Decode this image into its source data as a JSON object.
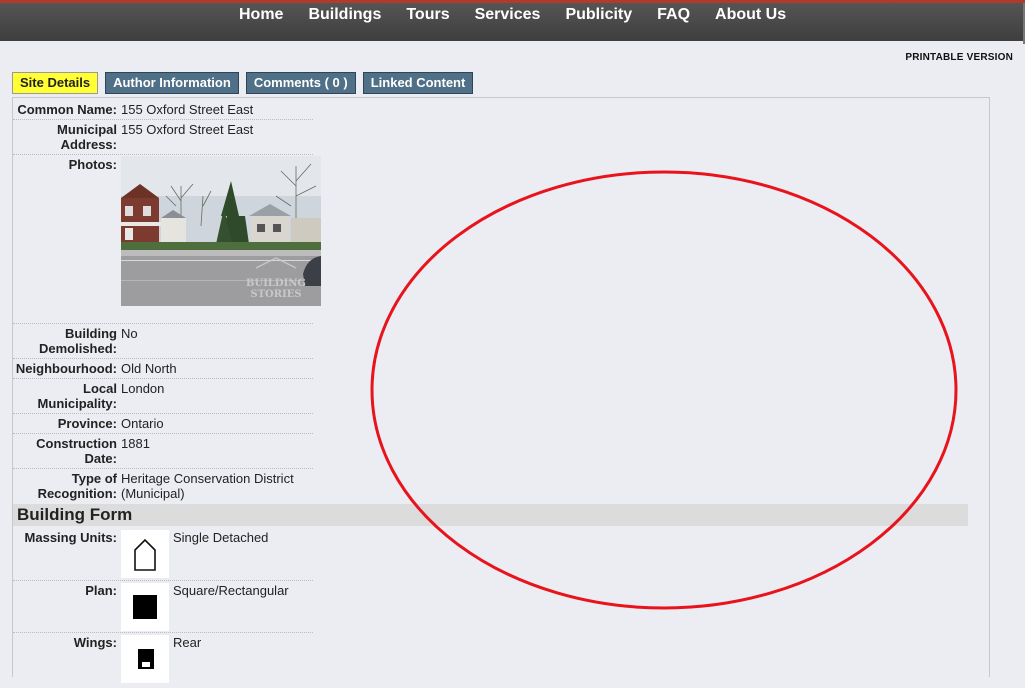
{
  "nav": {
    "items": [
      "Home",
      "Buildings",
      "Tours",
      "Services",
      "Publicity",
      "FAQ",
      "About Us"
    ]
  },
  "printable_label": "PRINTABLE VERSION",
  "tabs": {
    "site_details": "Site Details",
    "author": "Author Information",
    "comments": "Comments ( 0 )",
    "linked": "Linked Content"
  },
  "details": {
    "common_name_label": "Common Name:",
    "common_name": "155 Oxford Street East",
    "address_label_1": "Municipal",
    "address_label_2": "Address:",
    "address": "155 Oxford Street East",
    "photos_label": "Photos:",
    "photo_watermark_1": "BUILDING",
    "photo_watermark_2": "STORIES",
    "demolished_label_1": "Building",
    "demolished_label_2": "Demolished:",
    "demolished": "No",
    "neighbourhood_label": "Neighbourhood:",
    "neighbourhood": "Old North",
    "municipality_label_1": "Local",
    "municipality_label_2": "Municipality:",
    "municipality": "London",
    "province_label": "Province:",
    "province": "Ontario",
    "construction_label_1": "Construction",
    "construction_label_2": "Date:",
    "construction": "1881",
    "recognition_label_1": "Type of",
    "recognition_label_2": "Recognition:",
    "recognition_1": "Heritage Conservation District",
    "recognition_2": "(Municipal)"
  },
  "building_form": {
    "title": "Building Form",
    "massing_label": "Massing Units:",
    "massing": "Single Detached",
    "massing_icon": "house-outline-icon",
    "plan_label": "Plan:",
    "plan": "Square/Rectangular",
    "plan_icon": "square-plan-icon",
    "wings_label": "Wings:",
    "wings": "Rear",
    "wings_icon": "rear-wing-icon"
  },
  "colors": {
    "nav_bg": "#444444",
    "nav_top_border": "#b23a2a",
    "active_tab": "#ffff33",
    "inactive_tab": "#4f7086",
    "page_bg": "#ecedf3",
    "annotation": "#e8131b"
  }
}
